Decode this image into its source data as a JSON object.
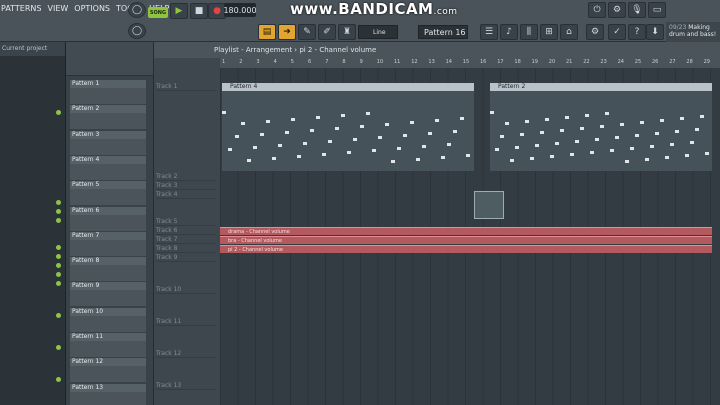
{
  "menu": [
    "PATTERNS",
    "VIEW",
    "OPTIONS",
    "TOOLS",
    "HELP"
  ],
  "transport": {
    "song_mode": "SONG",
    "tempo": "180.000"
  },
  "watermark": {
    "main": "www.BANDICAM",
    "suffix": ".com"
  },
  "toolbar": {
    "snap": "Line",
    "pattern": "Pattern 16"
  },
  "news": {
    "date": "09/23",
    "text": "Making drum and bass!"
  },
  "browser": {
    "header": "Current project"
  },
  "playlist": {
    "title": "Playlist - Arrangement",
    "breadcrumb": "pi 2 - Channel volume",
    "ruler": [
      "1",
      "2",
      "3",
      "4",
      "5",
      "6",
      "7",
      "8",
      "9",
      "10",
      "11",
      "12",
      "13",
      "14",
      "15",
      "16",
      "17",
      "18",
      "19",
      "20",
      "21",
      "22",
      "23",
      "24",
      "25",
      "26",
      "27",
      "28",
      "29",
      "30"
    ]
  },
  "patterns": [
    "Pattern 1",
    "Pattern 2",
    "Pattern 3",
    "Pattern 4",
    "Pattern 5",
    "Pattern 6",
    "Pattern 7",
    "Pattern 8",
    "Pattern 9",
    "Pattern 10",
    "Pattern 11",
    "Pattern 12",
    "Pattern 13"
  ],
  "tracks": [
    "Track 1",
    "Track 2",
    "Track 3",
    "Track 4",
    "Track 5",
    "Track 6",
    "Track 7",
    "Track 8",
    "Track 9",
    "Track 10",
    "Track 11",
    "Track 12",
    "Track 13"
  ],
  "clips": {
    "pattern4": "Pattern 4",
    "pattern2": "Pattern 2",
    "auto": [
      "drama - Channel volume",
      "bra - Channel volume",
      "pi 2 - Channel volume"
    ]
  },
  "colors": {
    "accent": "#8ec53f",
    "automation": "#b45a5f"
  }
}
